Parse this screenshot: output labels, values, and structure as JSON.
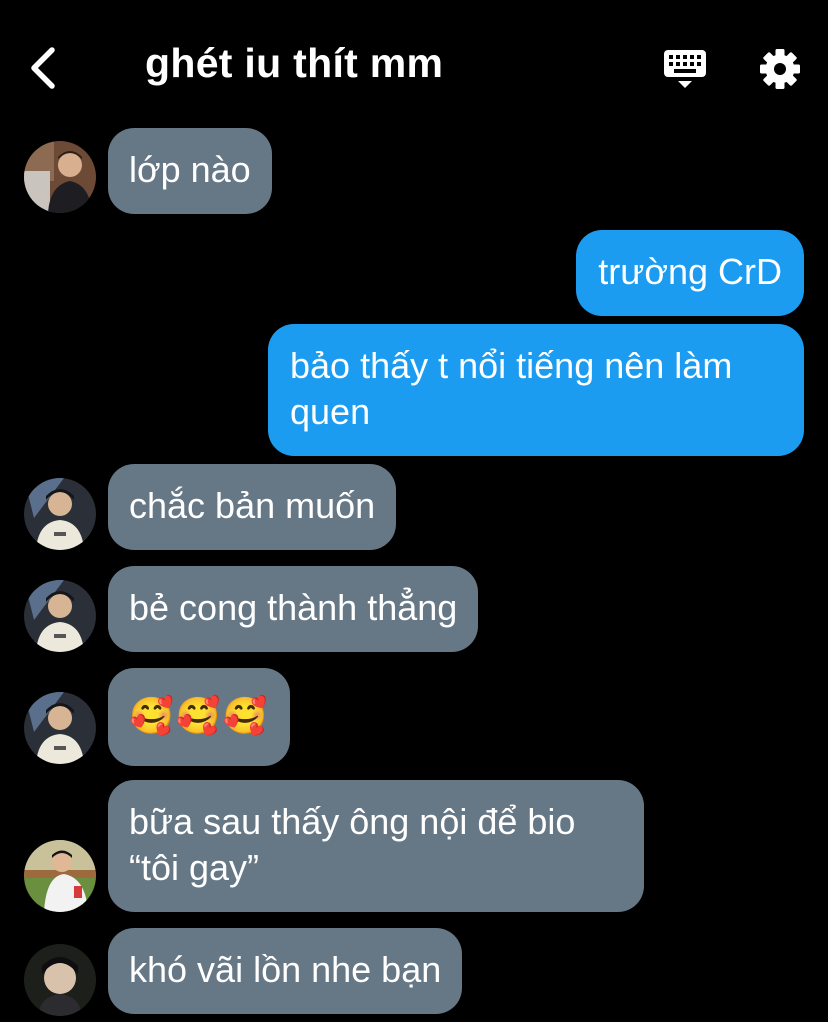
{
  "header": {
    "title": "ghét iu thít mm",
    "back_icon": "chevron-left-icon",
    "keyboard_icon": "keyboard-icon",
    "settings_icon": "gear-icon"
  },
  "colors": {
    "background": "#000000",
    "incoming_bubble": "#667786",
    "outgoing_bubble": "#1c9cf0",
    "text": "#ffffff"
  },
  "messages": [
    {
      "direction": "incoming",
      "text": "lớp nào"
    },
    {
      "direction": "outgoing",
      "text": "trường CrD"
    },
    {
      "direction": "outgoing",
      "text": "bảo thấy t nổi tiếng nên làm quen"
    },
    {
      "direction": "incoming",
      "text": "chắc bản muốn"
    },
    {
      "direction": "incoming",
      "text": "bẻ cong thành thẳng"
    },
    {
      "direction": "incoming",
      "text": "🥰🥰🥰"
    },
    {
      "direction": "incoming",
      "text": "bữa sau thấy ông nội để bio “tôi gay”"
    },
    {
      "direction": "incoming",
      "text": "khó vãi lồn nhe bạn"
    }
  ]
}
